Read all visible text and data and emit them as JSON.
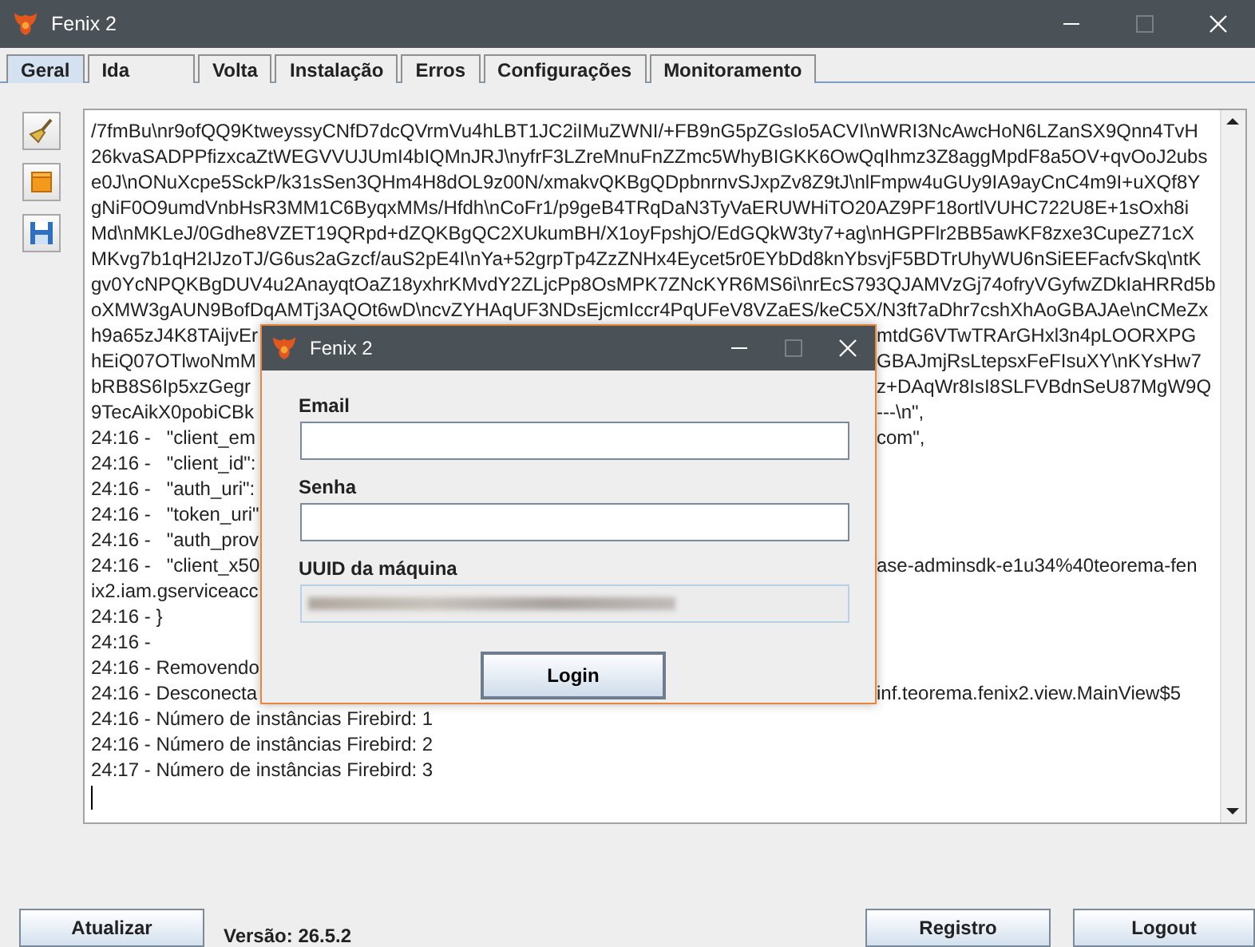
{
  "window": {
    "title": "Fenix 2"
  },
  "tabs": [
    {
      "label": "Geral",
      "selected": true
    },
    {
      "label": "Ida",
      "selected": false
    },
    {
      "label": "Volta",
      "selected": false
    },
    {
      "label": "Instalação",
      "selected": false
    },
    {
      "label": "Erros",
      "selected": false
    },
    {
      "label": "Configurações",
      "selected": false
    },
    {
      "label": "Monitoramento",
      "selected": false
    }
  ],
  "log": {
    "lines": [
      {
        "text": "/7fmBu\\nr9ofQQ9KtweyssyCNfD7dcQVrmVu4hLBT1JC2iIMuZWNI/+FB9nG5pZGsIo5ACVI\\nWRI3NcAwcHoN6LZanSX9Qnn4TvH"
      },
      {
        "text": "26kvaSADPPfizxcaZtWEGVVUJUmI4bIQMnJRJ\\nyfrF3LZreMnuFnZZmc5WhyBIGKK6OwQqIhmz3Z8aggMpdF8a5OV+qvOoJ2ubs"
      },
      {
        "text": "e0J\\nONuXcpe5SckP/k31sSen3QHm4H8dOL9z00N/xmakvQKBgQDpbnrnvSJxpZv8Z9tJ\\nlFmpw4uGUy9IA9ayCnC4m9I+uXQf8Y"
      },
      {
        "text": "gNiF0O9umdVnbHsR3MM1C6ByqxMMs/Hfdh\\nCoFr1/p9geB4TRqDaN3TyVaERUWHiTO20AZ9PF18ortlVUHC722U8E+1sOxh8i"
      },
      {
        "text": "Md\\nMKLeJ/0Gdhe8VZET19QRpd+dZQKBgQC2XUkumBH/X1oyFpshjO/EdGQkW3ty7+ag\\nHGPFlr2BB5awKF8zxe3CupeZ71cX"
      },
      {
        "text": "MKvg7b1qH2IJzoTJ/G6us2aGzcf/auS2pE4I\\nYa+52grpTp4ZzZNHx4Eycet5r0EYbDd8knYbsvjF5BDTrUhyWU6nSiEEFacfvSkq\\ntK"
      },
      {
        "text": "gv0YcNPQKBgDUV4u2AnayqtOaZ18yxhrKMvdY2ZLjcPp8OsMPK7ZNcKYR6MS6i\\nrEcS793QJAMVzGj74ofryVGyfwZDkIaHRRd5b"
      },
      {
        "text": "oXMW3gAUN9BofDqAMTj3AQOt6wD\\ncvZYHAqUF3NDsEjcmIccr4PqUFeV8VZaES/keC5X/N3ft7aDhr7cshXhAoGBAJAe\\nCMeZx"
      },
      {
        "text": "h9a65zJ4K8TAijvEr",
        "continued": "mtdG6VTwTRArGHxl3n4pLOORXPG"
      },
      {
        "text": "hEiQ07OTlwoNmM",
        "continued": "GBAJmjRsLtepsxFeFIsuXY\\nKYsHw7"
      },
      {
        "text": "bRB8S6Ip5xzGegr",
        "continued": "z+DAqWr8IsI8SLFVBdnSeU87MgW9Q"
      },
      {
        "text": "9TecAikX0pobiCBk",
        "continued": "---\\n\","
      },
      {
        "text": "24:16 -   \"client_em",
        "continued": "com\","
      },
      {
        "text": "24:16 -   \"client_id\":"
      },
      {
        "text": "24:16 -   \"auth_uri\":"
      },
      {
        "text": "24:16 -   \"token_uri\""
      },
      {
        "text": "24:16 -   \"auth_prov"
      },
      {
        "text": "24:16 -   \"client_x50",
        "continued": "ase-adminsdk-e1u34%40teorema-fen"
      },
      {
        "text": "ix2.iam.gserviceacc"
      },
      {
        "text": "24:16 - }"
      },
      {
        "text": "24:16 -"
      },
      {
        "text": "24:16 - Removendo"
      },
      {
        "text": "24:16 - Desconecta",
        "continued": "inf.teorema.fenix2.view.MainView$5"
      },
      {
        "text": "24:16 - Número de instâncias Firebird: 1"
      },
      {
        "text": "24:16 - Número de instâncias Firebird: 2"
      },
      {
        "text": "24:17 - Número de instâncias Firebird: 3"
      }
    ]
  },
  "dialog": {
    "title": "Fenix 2",
    "fields": [
      {
        "label": "Email",
        "kind": "text"
      },
      {
        "label": "Senha",
        "kind": "password"
      },
      {
        "label": "UUID da máquina",
        "kind": "blurred"
      }
    ],
    "button": "Login"
  },
  "footer": {
    "refresh_button": "Atualizar",
    "version": "Versão: 26.5.2",
    "register_button": "Registro",
    "logout_button": "Logout"
  }
}
